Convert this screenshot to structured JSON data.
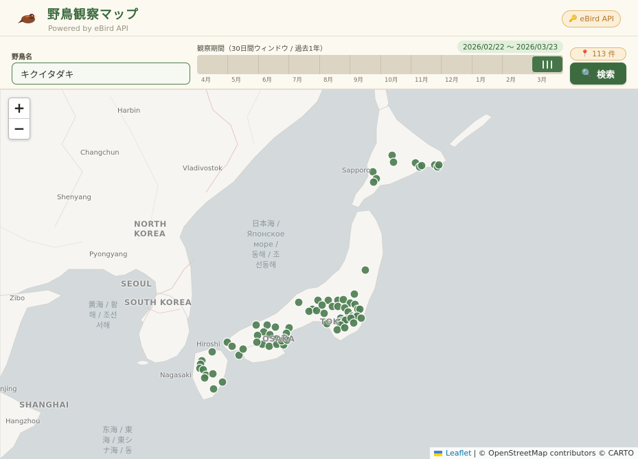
{
  "header": {
    "title": "野鳥観察マップ",
    "subtitle": "Powered by eBird API",
    "ebird_button_label": "eBird API",
    "ebird_button_icon": "key-icon"
  },
  "controls": {
    "species_label": "野鳥名",
    "species_value": "キクイタダキ",
    "period_label": "観察期間（30日間ウィンドウ / 過去1年）",
    "period_range": "2026/02/22 〜 2026/03/23",
    "months": [
      "4月",
      "5月",
      "6月",
      "7月",
      "8月",
      "9月",
      "10月",
      "11月",
      "12月",
      "1月",
      "2月",
      "3月"
    ],
    "count_label": "113 件",
    "search_label": "検索",
    "search_icon": "magnifier-icon"
  },
  "map": {
    "zoom_in": "+",
    "zoom_out": "−",
    "attribution_leaflet": "Leaflet",
    "attribution_rest": "| © OpenStreetMap contributors © CARTO",
    "labels": {
      "harbin": "Harbin",
      "changchun": "Changchun",
      "vladivostok": "Vladivostok",
      "shenyang": "Shenyang",
      "sapporo": "Sapporo",
      "north_korea": "NORTH\nKOREA",
      "pyongyang": "Pyongyang",
      "seoul": "SEOUL",
      "south_korea": "SOUTH KOREA",
      "zibo": "Zibo",
      "japan_sea": "日本海 /\nЯпонское\nморе /\n동해 / 조\n선동해",
      "yellow_sea": "黄海 / 황\n해 / 조선\n서해",
      "east_china_sea": "东海 / 東\n海 / 東シ\nナ海 / 동",
      "hiroshima": "Hiroshi",
      "osaka": "OSAKA",
      "tokyo": "TOK",
      "nagasaki": "Nagasaki",
      "shanghai": "SHANGHAI",
      "hangzhou": "Hangzhou",
      "nanjing": "njing"
    },
    "colors": {
      "land": "#f6f5f1",
      "water": "#d4dadc",
      "marker": "#4e7e53",
      "border": "#e8c4c4"
    }
  }
}
